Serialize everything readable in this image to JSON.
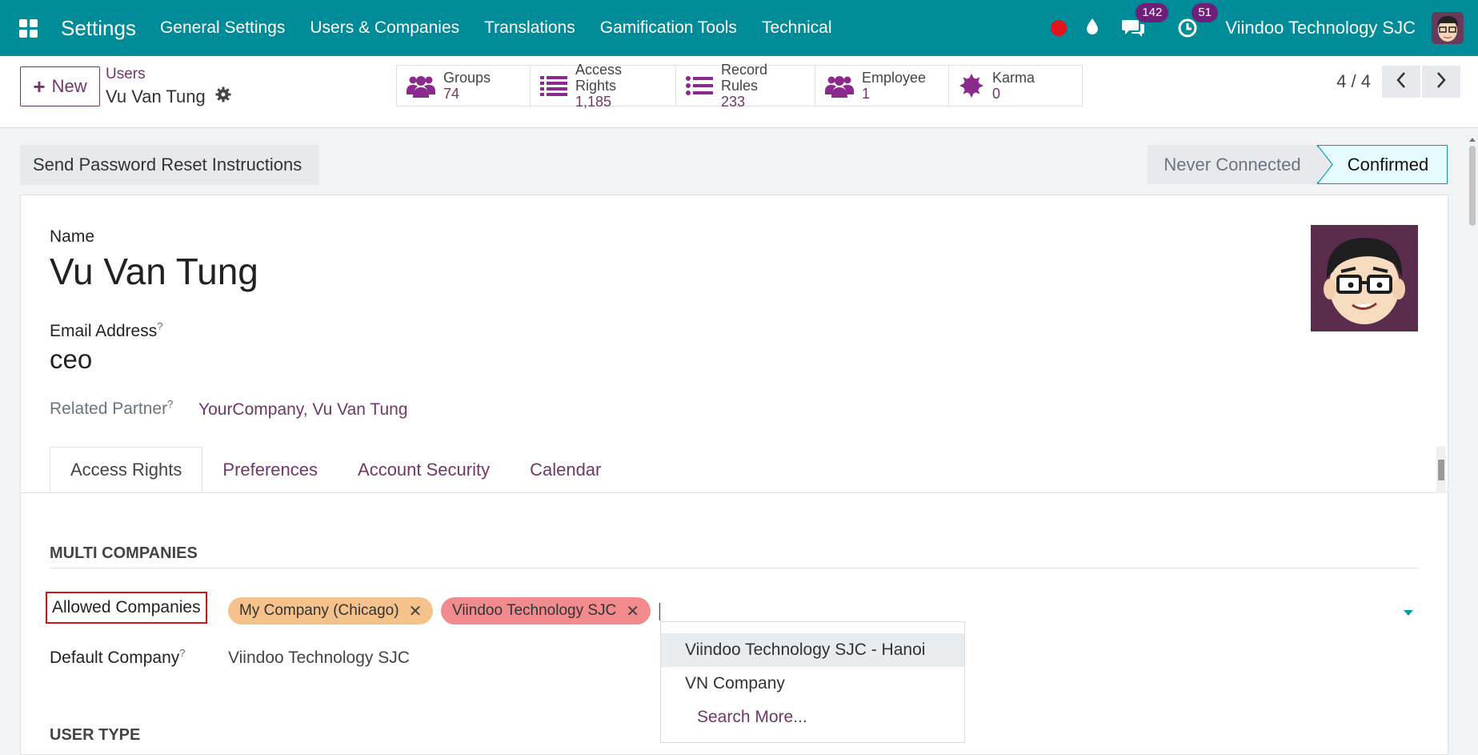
{
  "navbar": {
    "app_title": "Settings",
    "menu": [
      "General Settings",
      "Users & Companies",
      "Translations",
      "Gamification Tools",
      "Technical"
    ],
    "messages_count": "142",
    "activities_count": "51",
    "company": "Viindoo Technology SJC"
  },
  "control": {
    "new_label": "New",
    "breadcrumb_parent": "Users",
    "breadcrumb_current": "Vu Van Tung",
    "smart_buttons": [
      {
        "label": "Groups",
        "value": "74",
        "icon": "users-icon"
      },
      {
        "label": "Access Rights",
        "value": "1,185",
        "icon": "list-icon"
      },
      {
        "label": "Record Rules",
        "value": "233",
        "icon": "list-icon"
      },
      {
        "label": "Employee",
        "value": "1",
        "icon": "users-icon"
      },
      {
        "label": "Karma",
        "value": "0",
        "icon": "karma-icon"
      }
    ],
    "pager": "4 / 4"
  },
  "form": {
    "reset_button": "Send Password Reset Instructions",
    "stages": {
      "never": "Never Connected",
      "confirmed": "Confirmed"
    },
    "name_label": "Name",
    "name_value": "Vu Van Tung",
    "email_label": "Email Address",
    "email_value": "ceo",
    "help_mark": "?",
    "partner_label": "Related Partner",
    "partner_value": "YourCompany, Vu Van Tung",
    "tabs": [
      "Access Rights",
      "Preferences",
      "Account Security",
      "Calendar"
    ],
    "section_multi": "MULTI COMPANIES",
    "allowed_label": "Allowed Companies",
    "allowed_tags": [
      "My Company (Chicago)",
      "Viindoo Technology SJC"
    ],
    "default_label": "Default Company",
    "default_value": "Viindoo Technology SJC",
    "section_user_type": "USER TYPE",
    "dropdown": [
      "Viindoo Technology SJC - Hanoi",
      "VN Company",
      "Search More..."
    ]
  },
  "colors": {
    "navbar": "#008b99",
    "brand": "#71376b",
    "highlight": "#d0141b",
    "tag_orange": "#f6c28b",
    "tag_red": "#f28b8e"
  }
}
